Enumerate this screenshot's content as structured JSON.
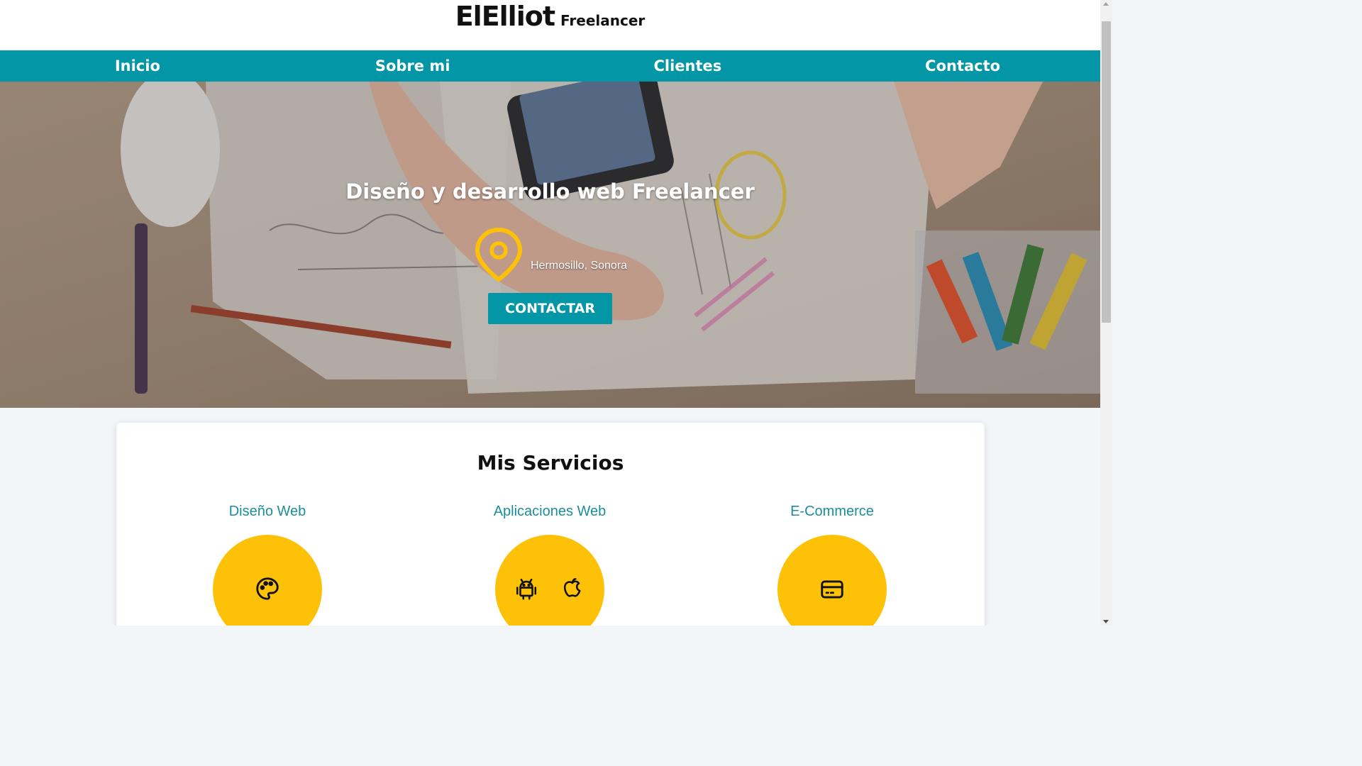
{
  "header": {
    "brand_name": "ElElliot",
    "brand_tagline": "Freelancer"
  },
  "nav": {
    "items": [
      {
        "label": "Inicio"
      },
      {
        "label": "Sobre mi"
      },
      {
        "label": "Clientes"
      },
      {
        "label": "Contacto"
      }
    ]
  },
  "hero": {
    "title": "Diseño y desarrollo web Freelancer",
    "location": "Hermosillo, Sonora",
    "location_icon": "map-pin-icon",
    "cta_label": "CONTACTAR"
  },
  "services": {
    "title": "Mis Servicios",
    "items": [
      {
        "label": "Diseño Web",
        "icons": [
          "palette-icon"
        ]
      },
      {
        "label": "Aplicaciones Web",
        "icons": [
          "android-icon",
          "apple-icon"
        ]
      },
      {
        "label": "E-Commerce",
        "icons": [
          "credit-card-icon"
        ]
      }
    ]
  },
  "colors": {
    "accent": "#0396a6",
    "yellow": "#fdc107",
    "service_label": "#1a8e9c"
  }
}
